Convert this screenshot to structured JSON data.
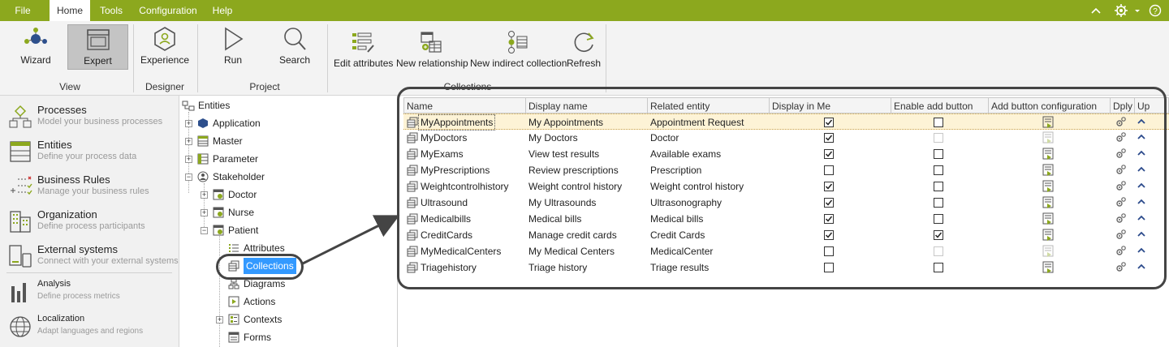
{
  "menubar": {
    "items": [
      {
        "label": "File"
      },
      {
        "label": "Home"
      },
      {
        "label": "Tools"
      },
      {
        "label": "Configuration"
      },
      {
        "label": "Help"
      }
    ],
    "right_icons": [
      "chevron-up-icon",
      "gear-icon",
      "dropdown-icon",
      "help-icon"
    ],
    "active": "Home"
  },
  "ribbon": {
    "groups": [
      {
        "label": "View",
        "buttons": [
          "Wizard",
          "Expert"
        ]
      },
      {
        "label": "Designer",
        "buttons": [
          "Experience"
        ]
      },
      {
        "label": "Project",
        "buttons": [
          "Run",
          "Search"
        ]
      },
      {
        "label": "Collections",
        "buttons": [
          "Edit attributes",
          "New relationship",
          "New indirect collection",
          "Refresh"
        ]
      }
    ]
  },
  "nav": {
    "items": [
      {
        "title": "Processes",
        "desc": "Model your business processes"
      },
      {
        "title": "Entities",
        "desc": "Define your process data"
      },
      {
        "title": "Business Rules",
        "desc": "Manage your business rules"
      },
      {
        "title": "Organization",
        "desc": "Define process participants"
      },
      {
        "title": "External systems",
        "desc": "Connect with your external systems"
      },
      {
        "title": "Analysis",
        "desc": "Define process metrics"
      },
      {
        "title": "Localization",
        "desc": "Adapt languages and regions"
      }
    ]
  },
  "tree": {
    "root": "Entities",
    "nodes": [
      "Application",
      "Master",
      "Parameter",
      "Stakeholder",
      "Doctor",
      "Nurse",
      "Patient",
      "Attributes",
      "Collections",
      "Diagrams",
      "Actions",
      "Contexts",
      "Forms"
    ]
  },
  "grid": {
    "columns": [
      "Name",
      "Display name",
      "Related entity",
      "Display in Me",
      "Enable add button",
      "Add button configuration",
      "Dply",
      "Up"
    ],
    "rows": [
      {
        "name": "MyAppointments",
        "display": "My Appointments",
        "related": "Appointment Request",
        "inme": true,
        "addbtn": false,
        "addbtn_disabled": false,
        "selected": true
      },
      {
        "name": "MyDoctors",
        "display": "My Doctors",
        "related": "Doctor",
        "inme": true,
        "addbtn": false,
        "addbtn_disabled": true,
        "selected": false
      },
      {
        "name": "MyExams",
        "display": "View test results",
        "related": "Available exams",
        "inme": true,
        "addbtn": false,
        "addbtn_disabled": false,
        "selected": false
      },
      {
        "name": "MyPrescriptions",
        "display": "Review prescriptions",
        "related": "Prescription",
        "inme": false,
        "addbtn": false,
        "addbtn_disabled": false,
        "selected": false
      },
      {
        "name": "Weightcontrolhistory",
        "display": "Weight control history",
        "related": "Weight control history",
        "inme": true,
        "addbtn": false,
        "addbtn_disabled": false,
        "selected": false
      },
      {
        "name": "Ultrasound",
        "display": "My Ultrasounds",
        "related": "Ultrasonography",
        "inme": true,
        "addbtn": false,
        "addbtn_disabled": false,
        "selected": false
      },
      {
        "name": "Medicalbills",
        "display": "Medical bills",
        "related": "Medical bills",
        "inme": true,
        "addbtn": false,
        "addbtn_disabled": false,
        "selected": false
      },
      {
        "name": "CreditCards",
        "display": "Manage credit cards",
        "related": "Credit Cards",
        "inme": true,
        "addbtn": true,
        "addbtn_disabled": false,
        "selected": false
      },
      {
        "name": "MyMedicalCenters",
        "display": "My Medical Centers",
        "related": "MedicalCenter",
        "inme": false,
        "addbtn": false,
        "addbtn_disabled": true,
        "selected": false
      },
      {
        "name": "Triagehistory",
        "display": "Triage history",
        "related": "Triage results",
        "inme": false,
        "addbtn": false,
        "addbtn_disabled": false,
        "selected": false
      }
    ]
  },
  "colors": {
    "accent": "#8ca81e",
    "selection": "#3399ff",
    "up_arrow": "#2b4a8b"
  }
}
